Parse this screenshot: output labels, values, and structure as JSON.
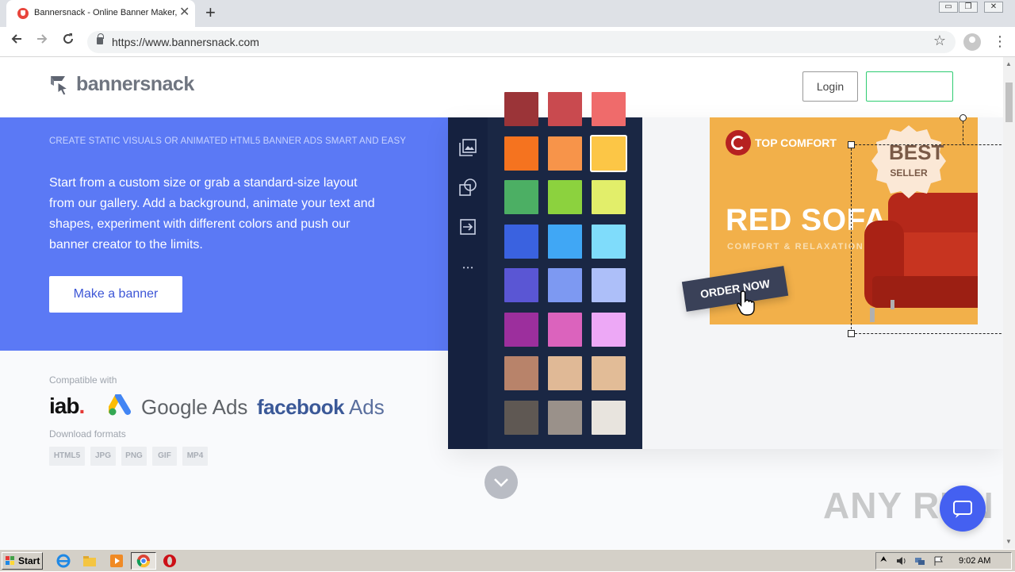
{
  "browser": {
    "tab_title": "Bannersnack - Online Banner Maker, ",
    "tab_close": "✕",
    "new_tab": "+",
    "url": "https://www.bannersnack.com",
    "window_controls": [
      "▭",
      "❐",
      "✕"
    ]
  },
  "header": {
    "logo_text": "bannersnack",
    "login_label": "Login",
    "signup_label": ""
  },
  "hero": {
    "tagline": "CREATE STATIC VISUALS OR ANIMATED HTML5 BANNER ADS SMART AND EASY",
    "description": "Start from a custom size or grab a standard-size layout from our gallery. Add a background, animate your text and shapes, experiment with different colors and push our banner creator to the limits.",
    "cta_label": "Make a banner"
  },
  "compat": {
    "label": "Compatible with",
    "iab": "iab",
    "iab_dot": ".",
    "google_ads": "Google Ads",
    "facebook": "facebook",
    "facebook_ads": " Ads"
  },
  "formats": {
    "label": "Download formats",
    "items": [
      "HTML5",
      "JPG",
      "PNG",
      "GIF",
      "MP4"
    ]
  },
  "editor": {
    "tools": [
      "images-icon",
      "shapes-icon",
      "import-icon",
      "more-icon"
    ],
    "more_glyph": "• • •",
    "swatches": [
      [
        "#9b3438",
        "#c94a4f",
        "#ef6b6b"
      ],
      [
        "#f5731f",
        "#f7944a",
        "#fcc646"
      ],
      [
        "#4caf64",
        "#8cd23e",
        "#e2ee6a"
      ],
      [
        "#3a62e0",
        "#40a7f5",
        "#7fdcfb"
      ],
      [
        "#5a56d4",
        "#7d99f2",
        "#adbff9"
      ],
      [
        "#9c2f9d",
        "#db63bd",
        "#eda8f6"
      ],
      [
        "#b8836a",
        "#e0b996",
        "#e2bc97"
      ],
      [
        "#5f5853",
        "#9a918a",
        "#e8e4de"
      ]
    ],
    "selected_swatch": "#fcc646",
    "ad": {
      "brand": "TOP COMFORT",
      "headline": "RED SOFA",
      "subheadline": "COMFORT & RELAXATION",
      "seal_best": "BEST",
      "seal_seller": "SELLER",
      "cta": "ORDER NOW"
    }
  },
  "watermark": "ANY RUN",
  "taskbar": {
    "start_label": "Start",
    "clock": "9:02 AM"
  },
  "colors": {
    "hero_bg": "#5b79f5",
    "editor_dark": "#15213f",
    "ad_bg": "#f2b04a",
    "accent_green": "#2ecc71"
  }
}
